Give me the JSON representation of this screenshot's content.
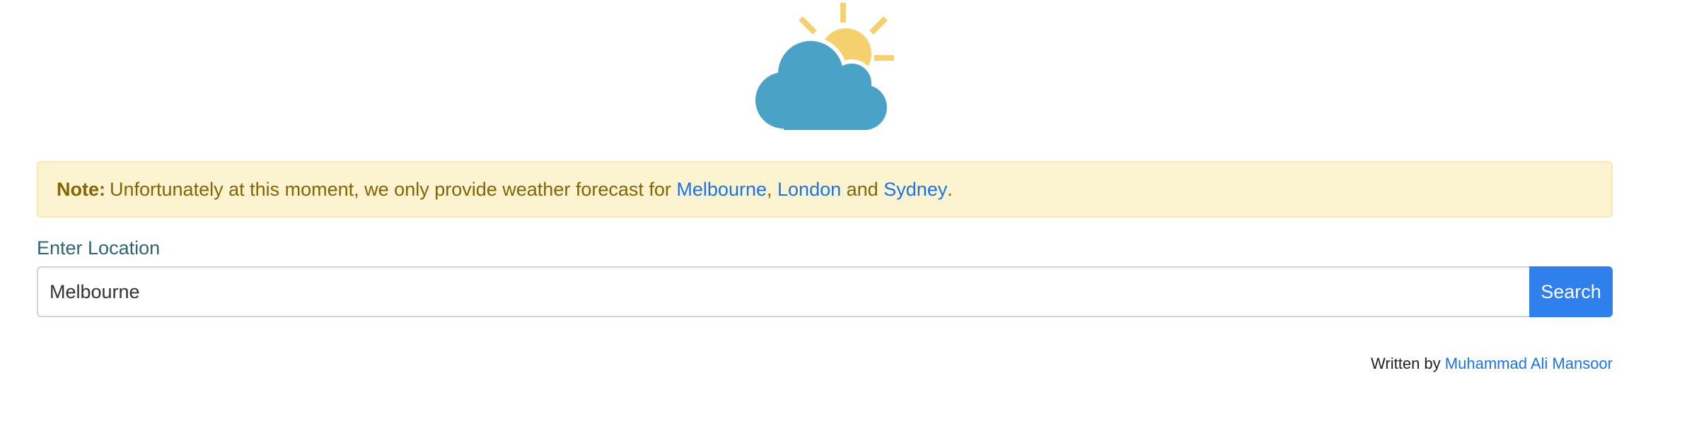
{
  "logo": {
    "icon": "partly-cloudy-icon",
    "colors": {
      "sun": "#f4d06f",
      "cloud": "#4aa3c7"
    }
  },
  "alert": {
    "note_label": "Note:",
    "message": "Unfortunately at this moment, we only provide weather forecast for",
    "cities": [
      "Melbourne",
      "London",
      "Sydney"
    ],
    "comma": ",",
    "and": "and",
    "period": "."
  },
  "search": {
    "label": "Enter Location",
    "value": "Melbourne",
    "button_label": "Search"
  },
  "footer": {
    "prefix": "Written by",
    "author": "Muhammad Ali Mansoor"
  },
  "colors": {
    "accent": "#2f80ed",
    "link": "#1a73e8",
    "alert_background": "#fcf3d1",
    "alert_text": "#856404",
    "label_text": "#2d6670"
  }
}
